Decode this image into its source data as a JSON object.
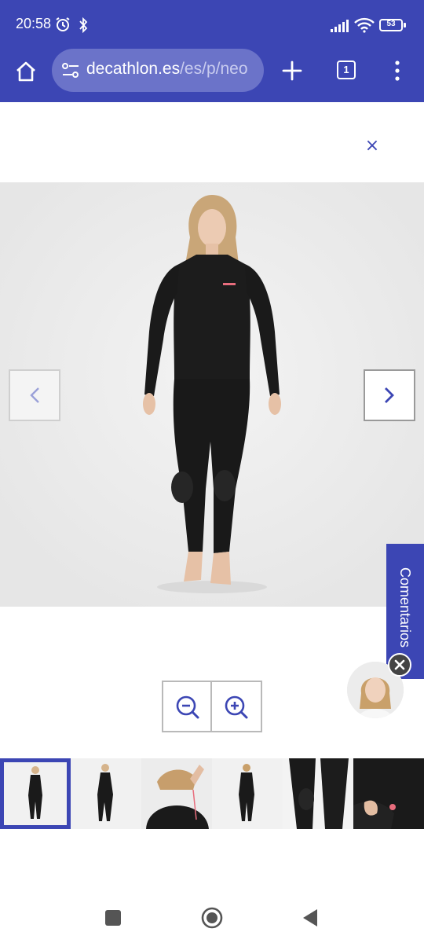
{
  "status_bar": {
    "time": "20:58",
    "battery_level": "53",
    "icons": [
      "alarm-icon",
      "bluetooth-icon",
      "signal-icon",
      "wifi-icon",
      "battery-icon"
    ]
  },
  "browser": {
    "url_domain": "decathlon.es",
    "url_path": "/es/p/neo",
    "tab_count": "1",
    "icons": [
      "home-icon",
      "site-settings-icon",
      "new-tab-icon",
      "menu-icon"
    ],
    "toolbar_color": "#3c46b4"
  },
  "gallery": {
    "close_label": "×",
    "icons": [
      "close-icon",
      "chevron-left-icon",
      "chevron-right-icon",
      "zoom-out-icon",
      "zoom-in-icon"
    ],
    "thumbnail_count": 6,
    "selected_thumbnail": 1
  },
  "comments_tab": {
    "label": "Comentarios"
  },
  "android_nav": {
    "icons": [
      "recents-icon",
      "home-circle-icon",
      "back-icon"
    ]
  }
}
